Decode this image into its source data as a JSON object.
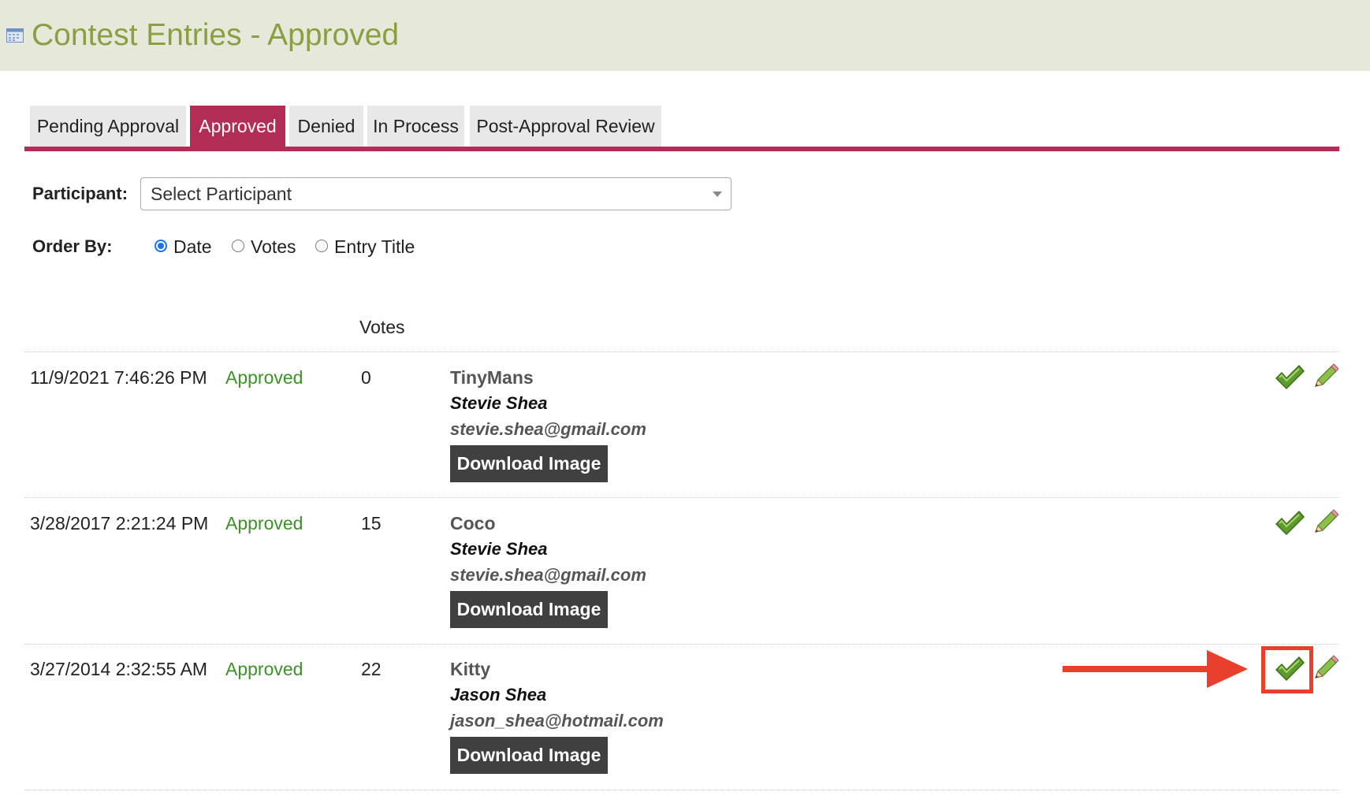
{
  "header": {
    "title": "Contest Entries - Approved",
    "icon": "calendar-icon",
    "background": "#e6e9d9",
    "title_color": "#8a9f41"
  },
  "tabs": [
    {
      "label": "Pending Approval",
      "active": false
    },
    {
      "label": "Approved",
      "active": true
    },
    {
      "label": "Denied",
      "active": false
    },
    {
      "label": "In Process",
      "active": false
    },
    {
      "label": "Post-Approval Review",
      "active": false
    }
  ],
  "accent_color": "#b22e56",
  "filters": {
    "participant_label": "Participant:",
    "participant_value": "Select Participant",
    "order_by_label": "Order By:",
    "order_options": [
      {
        "label": "Date",
        "checked": true
      },
      {
        "label": "Votes",
        "checked": false
      },
      {
        "label": "Entry Title",
        "checked": false
      }
    ]
  },
  "table": {
    "votes_header": "Votes",
    "rows": [
      {
        "date": "11/9/2021 7:46:26 PM",
        "status": "Approved",
        "votes": "0",
        "title": "TinyMans",
        "name": "Stevie Shea",
        "email": "stevie.shea@gmail.com",
        "button": "Download Image"
      },
      {
        "date": "3/28/2017 2:21:24 PM",
        "status": "Approved",
        "votes": "15",
        "title": "Coco",
        "name": "Stevie Shea",
        "email": "stevie.shea@gmail.com",
        "button": "Download Image"
      },
      {
        "date": "3/27/2014 2:32:55 AM",
        "status": "Approved",
        "votes": "22",
        "title": "Kitty",
        "name": "Jason Shea",
        "email": "jason_shea@hotmail.com",
        "button": "Download Image"
      }
    ],
    "row_icons": [
      "checkmark-icon",
      "pencil-icon"
    ]
  },
  "annotation": {
    "color": "#e8402d",
    "target": "checkmark-icon of third row"
  }
}
